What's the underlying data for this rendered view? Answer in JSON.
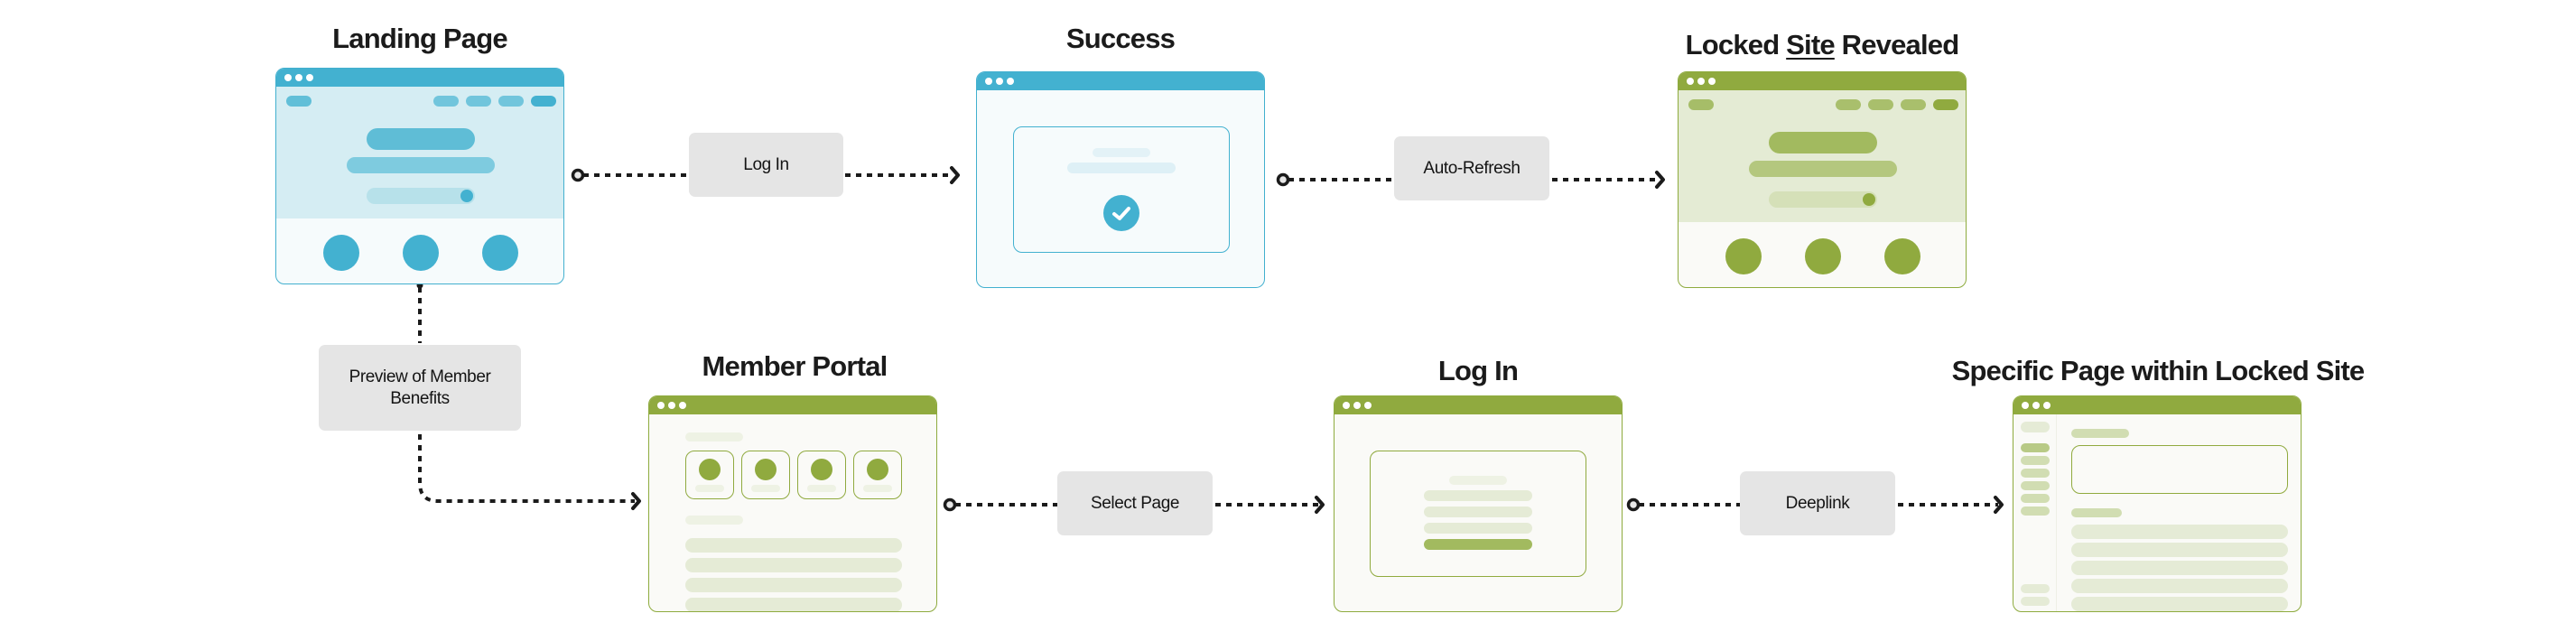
{
  "diagram": {
    "colors": {
      "blue_accent": "#43b1d0",
      "green_accent": "#90aa3f",
      "label_box_bg": "#e5e5e5",
      "connector": "#1b1b1b"
    },
    "screens": {
      "landing_page": {
        "title": "Landing Page",
        "theme": "blue"
      },
      "success": {
        "title": "Success",
        "theme": "blue",
        "icon": "check-circle-icon"
      },
      "locked_site_revealed": {
        "title_before": "Locked ",
        "title_underlined": "Site",
        "title_after": " Revealed",
        "theme": "green"
      },
      "member_portal": {
        "title": "Member Portal",
        "theme": "green"
      },
      "log_in": {
        "title": "Log In",
        "theme": "green"
      },
      "specific_page": {
        "title": "Specific Page within Locked Site",
        "theme": "green"
      }
    },
    "transitions": {
      "log_in": {
        "label": "Log In",
        "from": "Landing Page",
        "to": "Success"
      },
      "auto_refresh": {
        "label": "Auto-Refresh",
        "from": "Success",
        "to": "Locked Site Revealed"
      },
      "preview": {
        "label": "Preview of Member Benefits",
        "from": "Landing Page",
        "to": "Member Portal"
      },
      "select_page": {
        "label": "Select Page",
        "from": "Member Portal",
        "to": "Log In"
      },
      "deeplink": {
        "label": "Deeplink",
        "from": "Log In",
        "to": "Specific Page within Locked Site"
      }
    }
  }
}
